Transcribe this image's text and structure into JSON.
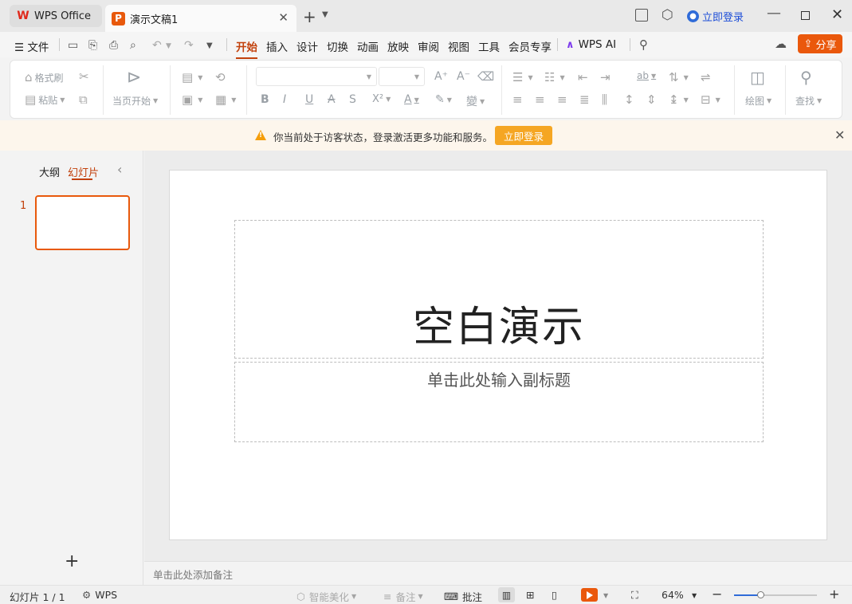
{
  "titlebar": {
    "home_tab": "WPS Office",
    "doc_tab": "演示文稿1",
    "login": "立即登录"
  },
  "menubar": {
    "file": "文件",
    "tabs": [
      "开始",
      "插入",
      "设计",
      "切换",
      "动画",
      "放映",
      "审阅",
      "视图",
      "工具",
      "会员专享"
    ],
    "active_tab": "开始",
    "wps_ai": "WPS AI",
    "share": "分享"
  },
  "ribbon": {
    "format_painter": "格式刷",
    "paste": "粘贴",
    "play_from_current": "当页开始",
    "draw": "绘图",
    "find": "查找"
  },
  "notice": {
    "message": "你当前处于访客状态，登录激活更多功能和服务。",
    "login_button": "立即登录"
  },
  "left_panel": {
    "outline_tab": "大纲",
    "slides_tab": "幻灯片",
    "slide_number": "1"
  },
  "slide": {
    "title": "空白演示",
    "subtitle": "单击此处输入副标题"
  },
  "notes": {
    "placeholder": "单击此处添加备注"
  },
  "statusbar": {
    "slide_counter": "幻灯片 1 / 1",
    "wps_label": "WPS",
    "smart_beautify": "智能美化",
    "notes_toggle": "备注",
    "comments": "批注",
    "zoom_level": "64%",
    "zoom_fraction": 0.33
  },
  "colors": {
    "accent": "#c2410c",
    "share_button": "#ea580c",
    "notice_button": "#f5a623",
    "notice_bg": "#fdf6ec"
  }
}
